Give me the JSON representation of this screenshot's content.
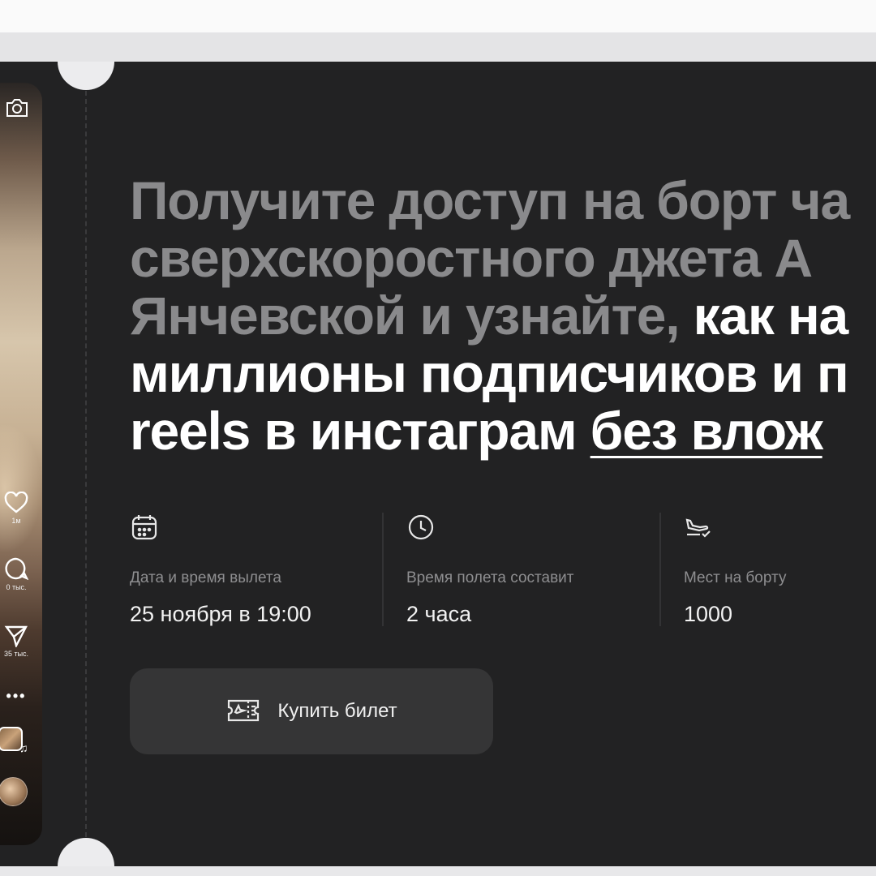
{
  "headline": {
    "line1": "Получите доступ на борт ча",
    "line2": "сверхскоростного джета А",
    "line3_dim": "Янчевской и узнайте, ",
    "line3_bright": "как на",
    "line4": "миллионы подписчиков и п",
    "line5_plain": "reels в инстаграм ",
    "line5_underlined": "без влож"
  },
  "phone": {
    "likes_count": "1м",
    "comments_count": "0 тыс.",
    "shares_count": "35 тыс.",
    "icons": [
      "camera-icon",
      "heart-icon",
      "comment-icon",
      "send-icon",
      "more-icon",
      "music-icon"
    ]
  },
  "info": [
    {
      "icon": "calendar-icon",
      "label": "Дата и время вылета",
      "value": "25 ноября в 19:00"
    },
    {
      "icon": "clock-icon",
      "label": "Время полета составит",
      "value": "2 часа"
    },
    {
      "icon": "plane-landing-icon",
      "label": "Мест на борту",
      "value": "1000"
    }
  ],
  "cta": {
    "label": "Купить билет",
    "icon": "ticket-icon"
  },
  "colors": {
    "ticket_bg": "#222223",
    "button_bg": "#353536",
    "text_dim": "#8a8a8c",
    "text_bright": "#ffffff",
    "page_bg": "#f4f4f5"
  }
}
